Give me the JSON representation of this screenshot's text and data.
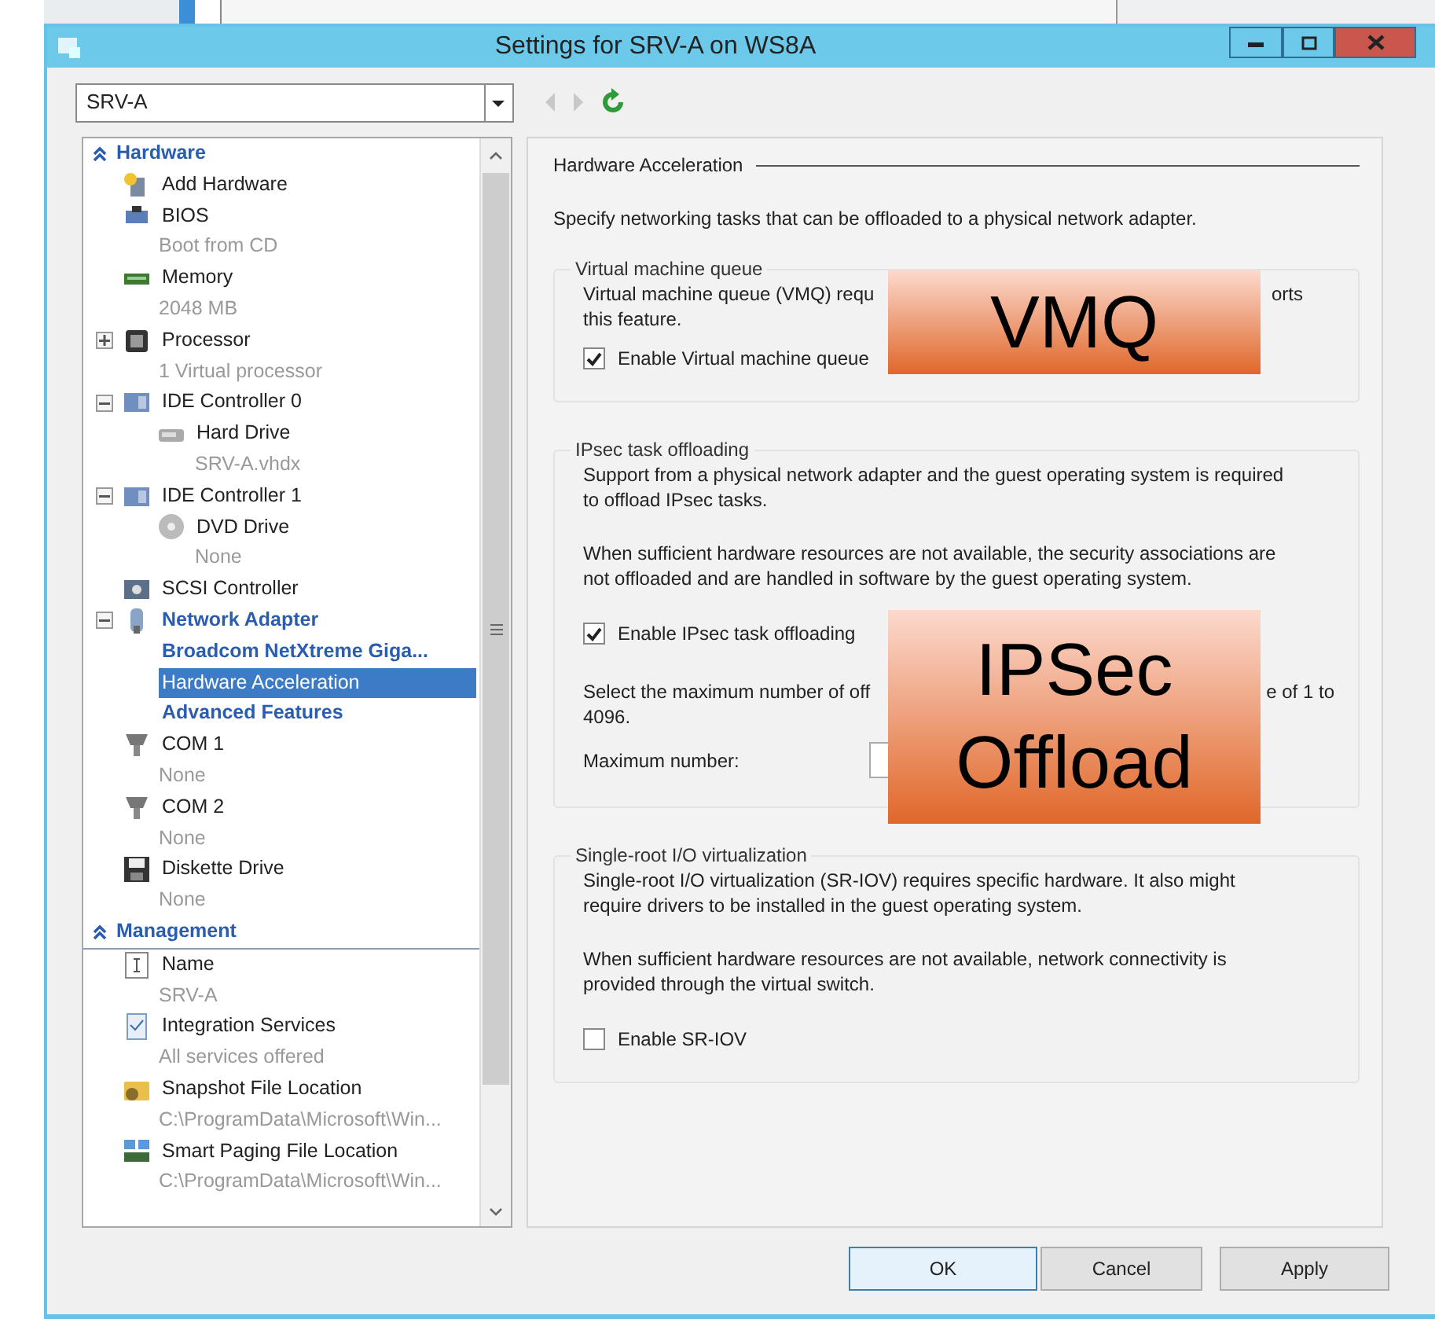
{
  "window": {
    "title": "Settings for SRV-A on WS8A"
  },
  "vm_selector": {
    "value": "SRV-A"
  },
  "sidebar": {
    "sections": [
      {
        "title": "Hardware",
        "expanded": true,
        "items": [
          {
            "label": "Add Hardware",
            "kind": "device",
            "selected": false
          },
          {
            "label": "BIOS",
            "detail": "Boot from CD",
            "kind": "device",
            "selected": false
          },
          {
            "label": "Memory",
            "detail": "2048 MB",
            "kind": "device",
            "selected": false
          },
          {
            "label": "Processor",
            "detail": "1 Virtual processor",
            "kind": "device",
            "expanded": false,
            "selected": false
          },
          {
            "label": "IDE Controller 0",
            "kind": "device",
            "expanded": true,
            "selected": false,
            "children": [
              {
                "label": "Hard Drive",
                "detail": "SRV-A.vhdx",
                "kind": "device",
                "selected": false
              }
            ]
          },
          {
            "label": "IDE Controller 1",
            "kind": "device",
            "expanded": true,
            "selected": false,
            "children": [
              {
                "label": "DVD Drive",
                "detail": "None",
                "kind": "device",
                "selected": false
              }
            ]
          },
          {
            "label": "SCSI Controller",
            "kind": "device",
            "selected": false
          },
          {
            "label": "Network Adapter",
            "kind": "adapter",
            "expanded": true,
            "selected": false,
            "children": [
              {
                "label": "Broadcom NetXtreme Giga...",
                "kind": "page",
                "selected": false
              },
              {
                "label": "Hardware Acceleration",
                "kind": "page",
                "selected": true
              },
              {
                "label": "Advanced Features",
                "kind": "page",
                "selected": false
              }
            ]
          },
          {
            "label": "COM 1",
            "detail": "None",
            "kind": "device",
            "selected": false
          },
          {
            "label": "COM 2",
            "detail": "None",
            "kind": "device",
            "selected": false
          },
          {
            "label": "Diskette Drive",
            "detail": "None",
            "kind": "device",
            "selected": false
          }
        ]
      },
      {
        "title": "Management",
        "expanded": true,
        "items": [
          {
            "label": "Name",
            "detail": "SRV-A",
            "kind": "device",
            "selected": false
          },
          {
            "label": "Integration Services",
            "detail": "All services offered",
            "kind": "device",
            "selected": false
          },
          {
            "label": "Snapshot File Location",
            "detail": "C:\\ProgramData\\Microsoft\\Win...",
            "kind": "device",
            "selected": false
          },
          {
            "label": "Smart Paging File Location",
            "detail": "C:\\ProgramData\\Microsoft\\Win...",
            "kind": "device",
            "selected": false
          }
        ]
      }
    ]
  },
  "panel": {
    "heading": "Hardware Acceleration",
    "intro": "Specify networking tasks that can be offloaded to a physical network adapter.",
    "groups": [
      {
        "title": "Virtual machine queue",
        "blocks": [
          {
            "kind": "split",
            "left": "Virtual machine queue (VMQ) requ",
            "right": "orts",
            "rest": "this feature."
          },
          {
            "kind": "checkbox",
            "label": "Enable Virtual machine queue",
            "checked": true
          }
        ]
      },
      {
        "title": "IPsec task offloading",
        "blocks": [
          {
            "kind": "text",
            "text": "Support from a physical network adapter and the guest operating system is required to offload IPsec tasks."
          },
          {
            "kind": "text",
            "text": "When sufficient hardware resources are not available, the security associations are not offloaded and are handled in software by the guest operating system."
          },
          {
            "kind": "checkbox",
            "label": "Enable IPsec task offloading",
            "checked": true
          },
          {
            "kind": "split",
            "left": "Select the maximum number of off",
            "right": "e of 1 to",
            "rest": "4096."
          },
          {
            "kind": "number",
            "label": "Maximum number:"
          }
        ]
      },
      {
        "title": "Single-root I/O virtualization",
        "blocks": [
          {
            "kind": "text",
            "text": "Single-root I/O virtualization (SR-IOV) requires specific hardware. It also might require drivers to be installed in the guest operating system."
          },
          {
            "kind": "text",
            "text": "When sufficient hardware resources are not available, network connectivity is provided through the virtual switch."
          },
          {
            "kind": "checkbox",
            "label": "Enable SR-IOV",
            "checked": false
          }
        ]
      }
    ]
  },
  "buttons": [
    {
      "label": "OK",
      "focused": true
    },
    {
      "label": "Cancel",
      "focused": false
    },
    {
      "label": "Apply",
      "focused": false
    }
  ],
  "callouts": [
    {
      "lines": [
        "VMQ"
      ]
    },
    {
      "lines": [
        "IPSec",
        "Offload"
      ]
    }
  ]
}
